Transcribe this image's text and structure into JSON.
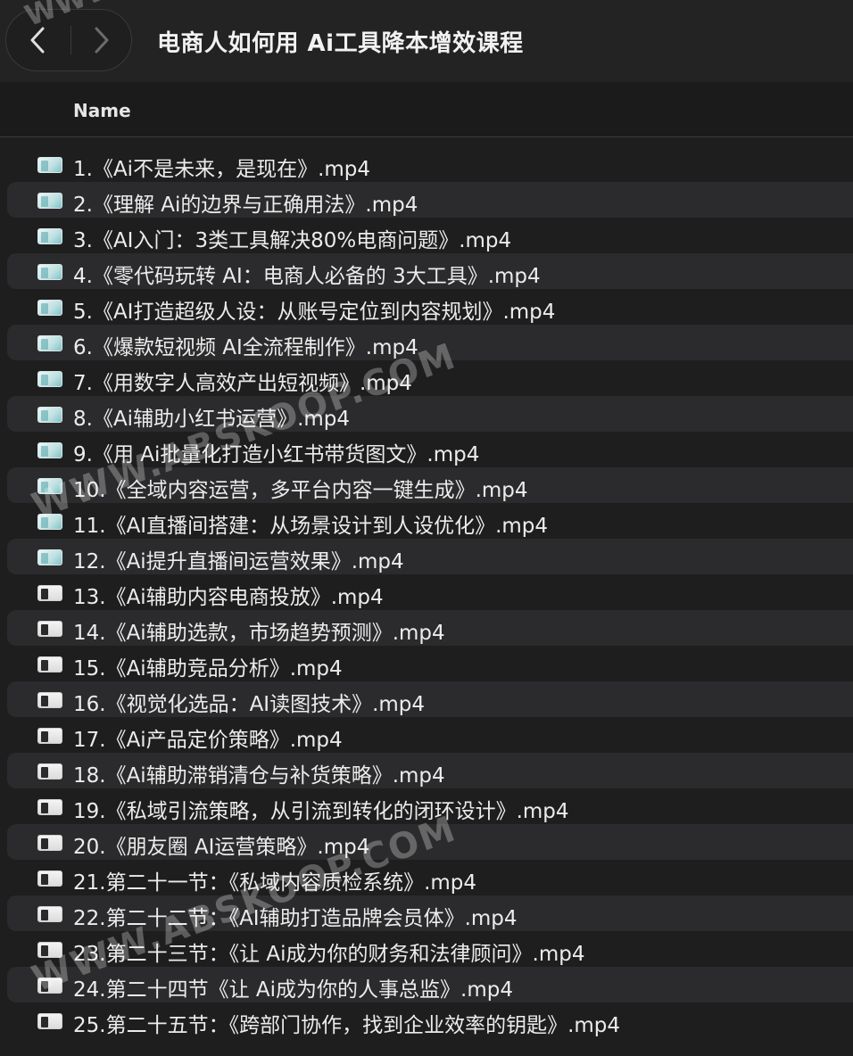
{
  "window": {
    "title": "电商人如何用 Ai工具降本增效课程"
  },
  "toolbar": {
    "back_icon": "chevron-left-icon",
    "forward_icon": "chevron-right-icon"
  },
  "header": {
    "name_column": "Name"
  },
  "files": [
    {
      "name": "1.《Ai不是未来，是现在》.mp4",
      "thumb": "light"
    },
    {
      "name": "2.《理解 Ai的边界与正确用法》.mp4",
      "thumb": "light"
    },
    {
      "name": "3.《AI入门：3类工具解决80%电商问题》.mp4",
      "thumb": "light"
    },
    {
      "name": "4.《零代码玩转 AI：电商人必备的 3大工具》.mp4",
      "thumb": "light"
    },
    {
      "name": "5.《AI打造超级人设：从账号定位到内容规划》.mp4",
      "thumb": "light"
    },
    {
      "name": "6.《爆款短视频 AI全流程制作》.mp4",
      "thumb": "light"
    },
    {
      "name": "7.《用数字人高效产出短视频》.mp4",
      "thumb": "light"
    },
    {
      "name": "8.《Ai辅助小红书运营》.mp4",
      "thumb": "light"
    },
    {
      "name": "9.《用 Ai批量化打造小红书带货图文》.mp4",
      "thumb": "light"
    },
    {
      "name": "10.《全域内容运营，多平台内容一键生成》.mp4",
      "thumb": "light"
    },
    {
      "name": "11.《AI直播间搭建：从场景设计到人设优化》.mp4",
      "thumb": "light"
    },
    {
      "name": "12.《Ai提升直播间运营效果》.mp4",
      "thumb": "light"
    },
    {
      "name": "13.《Ai辅助内容电商投放》.mp4",
      "thumb": "dark"
    },
    {
      "name": "14.《Ai辅助选款，市场趋势预测》.mp4",
      "thumb": "dark"
    },
    {
      "name": "15.《Ai辅助竞品分析》.mp4",
      "thumb": "dark"
    },
    {
      "name": "16.《视觉化选品：AI读图技术》.mp4",
      "thumb": "dark"
    },
    {
      "name": "17.《Ai产品定价策略》.mp4",
      "thumb": "dark"
    },
    {
      "name": "18.《Ai辅助滞销清仓与补货策略》.mp4",
      "thumb": "dark"
    },
    {
      "name": "19.《私域引流策略，从引流到转化的闭环设计》.mp4",
      "thumb": "dark"
    },
    {
      "name": "20.《朋友圈 AI运营策略》.mp4",
      "thumb": "dark"
    },
    {
      "name": "21.第二十一节：《私域内容质检系统》.mp4",
      "thumb": "dark"
    },
    {
      "name": "22.第二十二节：《AI辅助打造品牌会员体》.mp4",
      "thumb": "dark"
    },
    {
      "name": "23.第二十三节：《让 Ai成为你的财务和法律顾问》.mp4",
      "thumb": "dark"
    },
    {
      "name": "24.第二十四节《让 Ai成为你的人事总监》.mp4",
      "thumb": "dark"
    },
    {
      "name": "25.第二十五节：《跨部门协作，找到企业效率的钥匙》.mp4",
      "thumb": "dark"
    }
  ],
  "watermarks": {
    "top": "WWW",
    "text": "WWW.ABSKOOP.COM"
  }
}
